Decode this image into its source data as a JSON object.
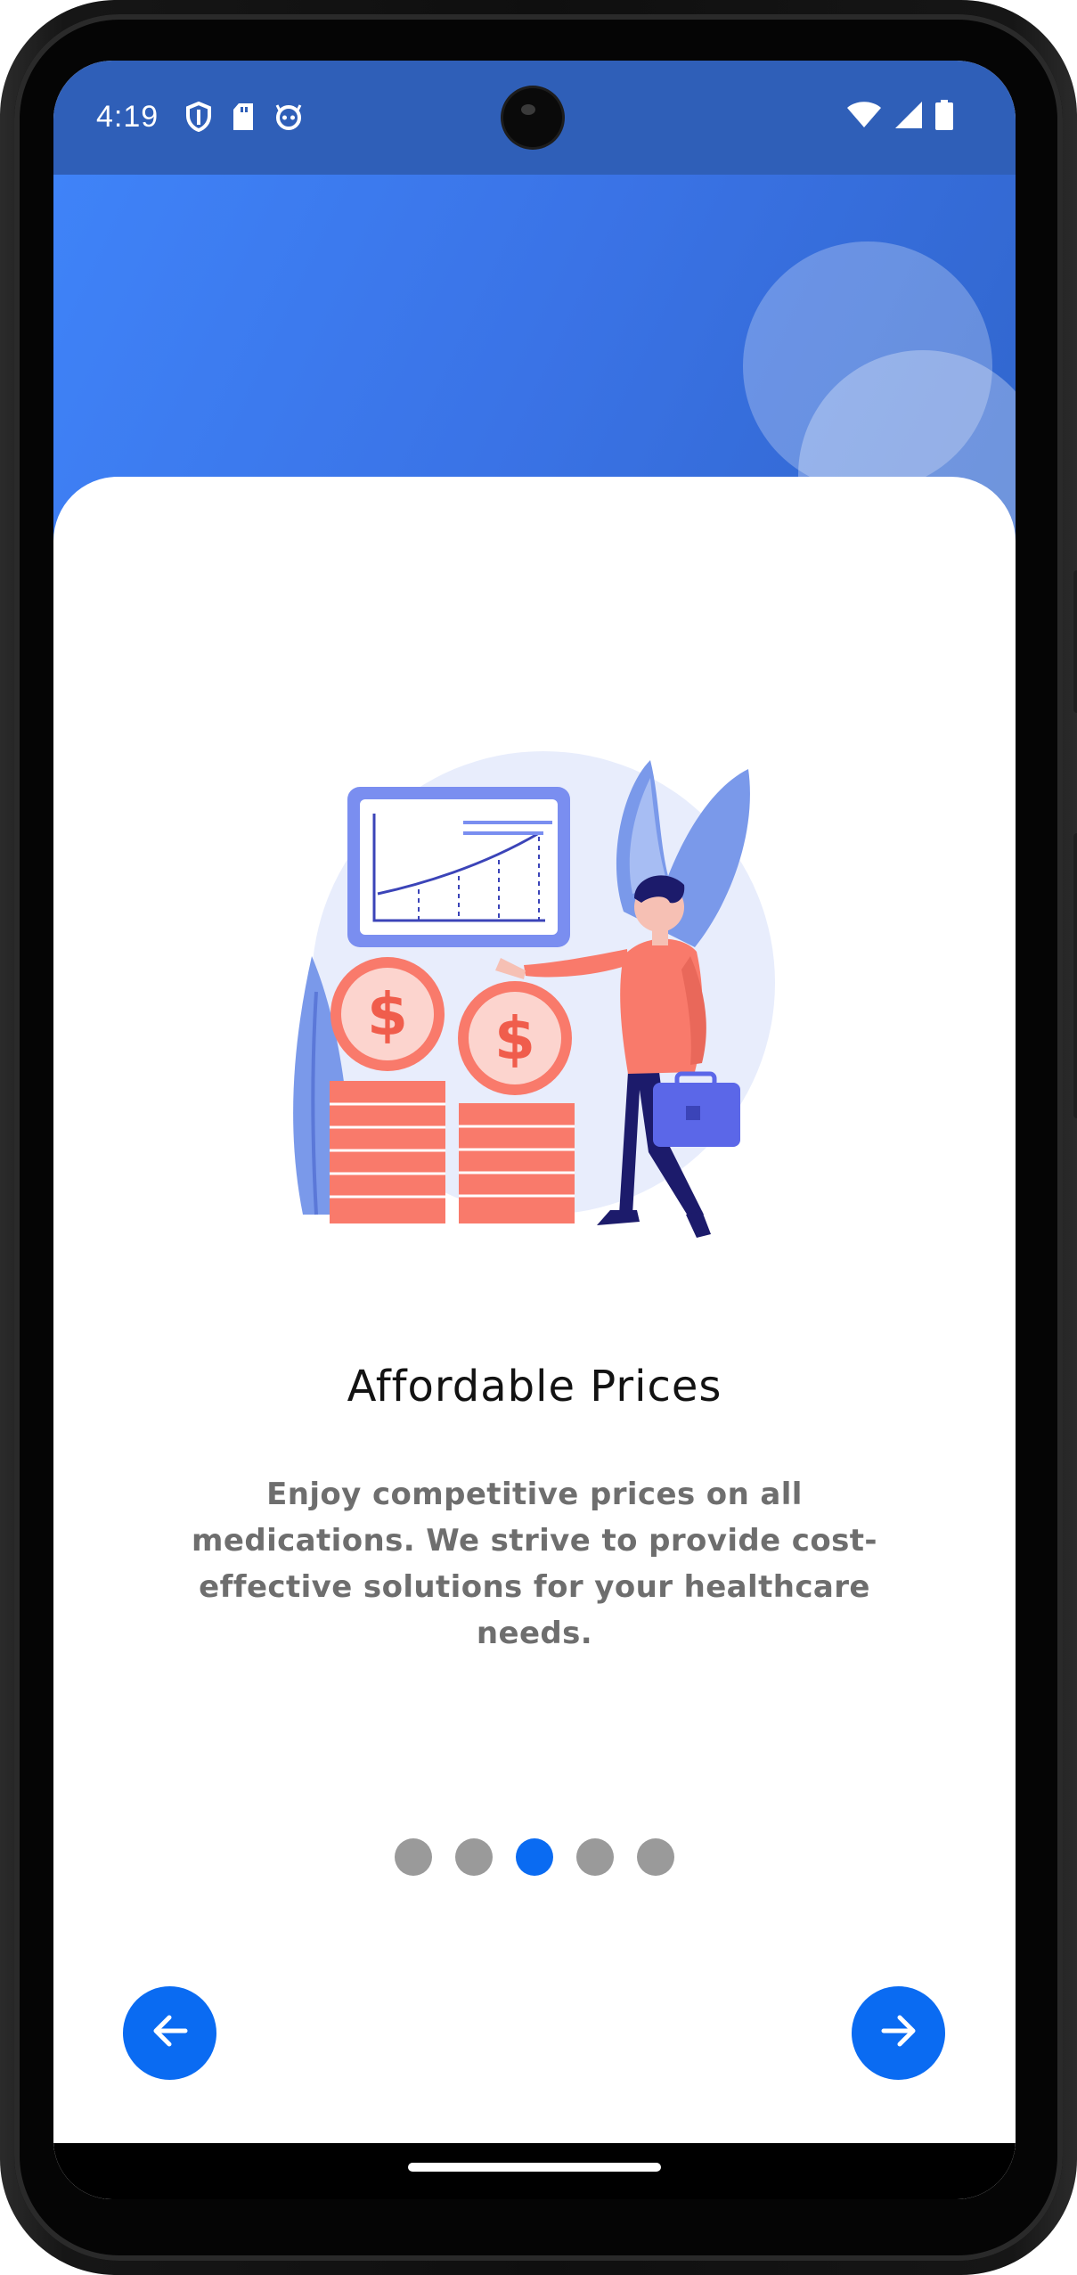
{
  "status_bar": {
    "time": "4:19",
    "left_icons": [
      "shield-icon",
      "sd-card-icon",
      "face-icon"
    ],
    "right_icons": [
      "wifi-icon",
      "signal-icon",
      "battery-icon"
    ]
  },
  "onboarding": {
    "title": "Affordable Prices",
    "description": "Enjoy competitive prices on all medications. We strive to provide cost-effective solutions for your healthcare needs.",
    "illustration": "affordable-prices-illustration",
    "page_count": 5,
    "current_page": 3
  },
  "navigation": {
    "back_icon": "arrow-left-icon",
    "next_icon": "arrow-right-icon"
  },
  "colors": {
    "accent": "#0a6bf2",
    "header_blue": "#3f83f8",
    "status_bar": "#2f5fb8",
    "dot_inactive": "#9a9a9a",
    "title_text": "#121212",
    "body_text": "#6e6e6e",
    "illustration_coral": "#f97a6b",
    "illustration_purple": "#5b67e8",
    "illustration_navy": "#1c1b6b"
  }
}
